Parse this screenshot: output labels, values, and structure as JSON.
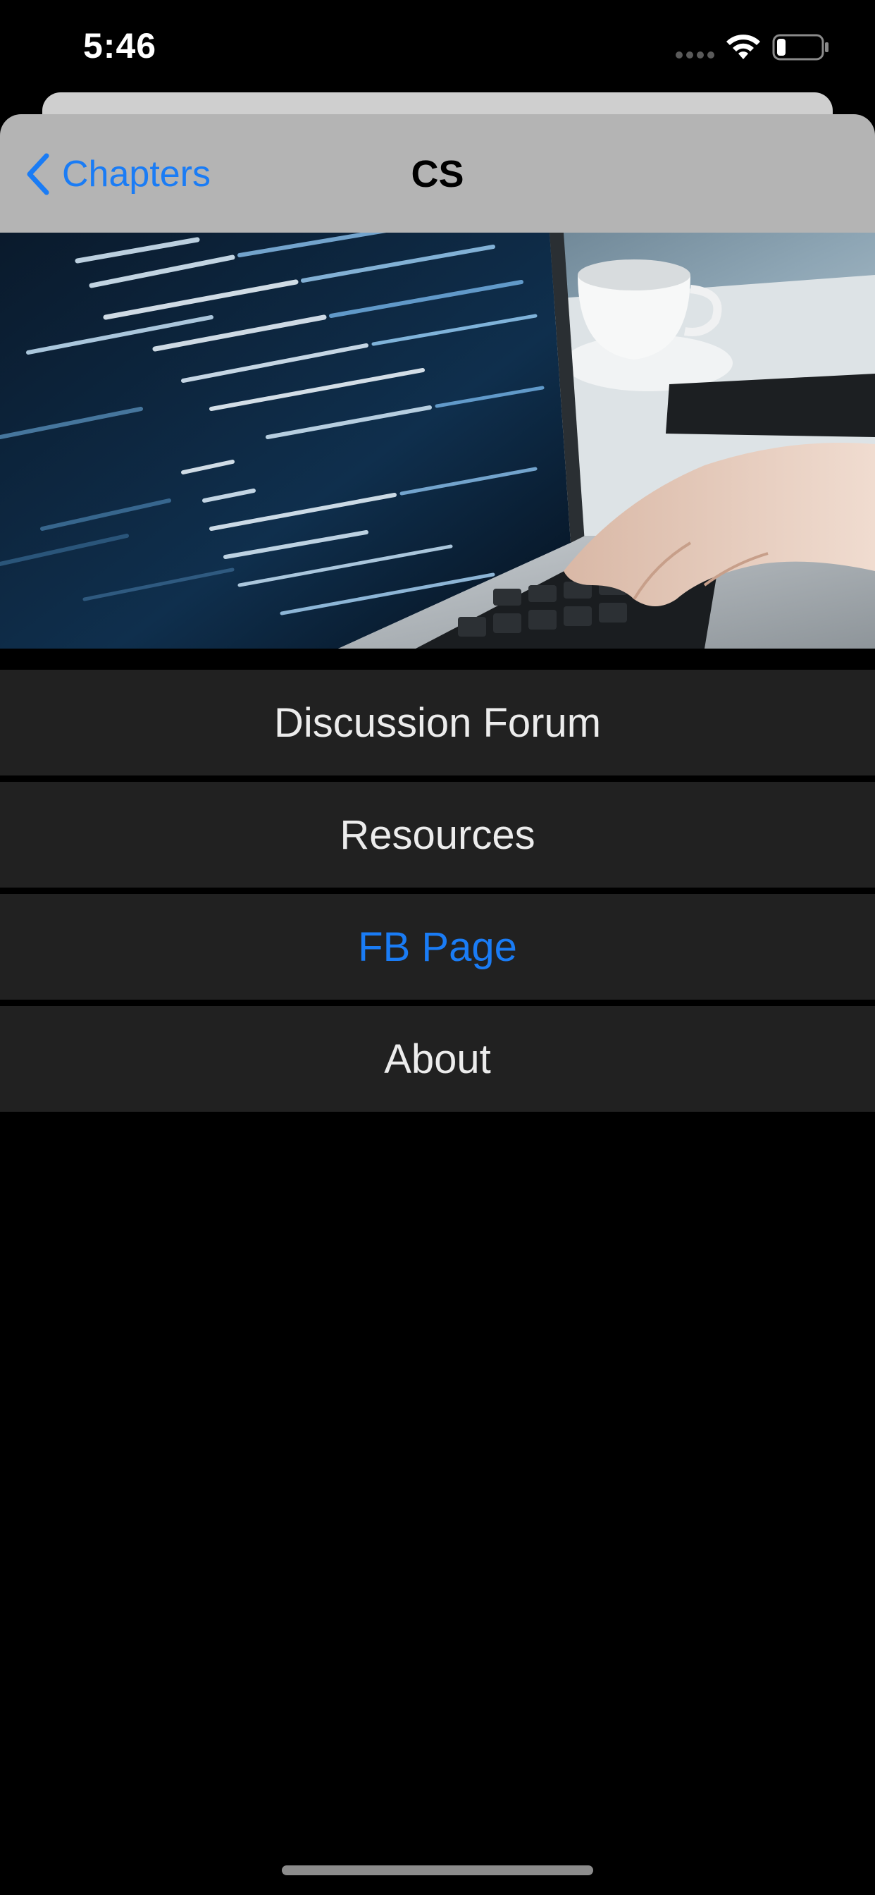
{
  "status_bar": {
    "time": "5:46",
    "icons": [
      "cellular-signal-icon",
      "wifi-icon",
      "battery-icon"
    ]
  },
  "nav": {
    "back_label": "Chapters",
    "title": "CS"
  },
  "hero": {
    "description_icon": "laptop-code-photo"
  },
  "menu": {
    "items": [
      {
        "label": "Discussion Forum"
      },
      {
        "label": "Resources"
      },
      {
        "label": "FB Page"
      },
      {
        "label": "About"
      }
    ]
  },
  "colors": {
    "accent": "#1a7cf5",
    "nav_background": "#b4b4b4",
    "button_background": "#212121",
    "page_background": "#000000"
  }
}
